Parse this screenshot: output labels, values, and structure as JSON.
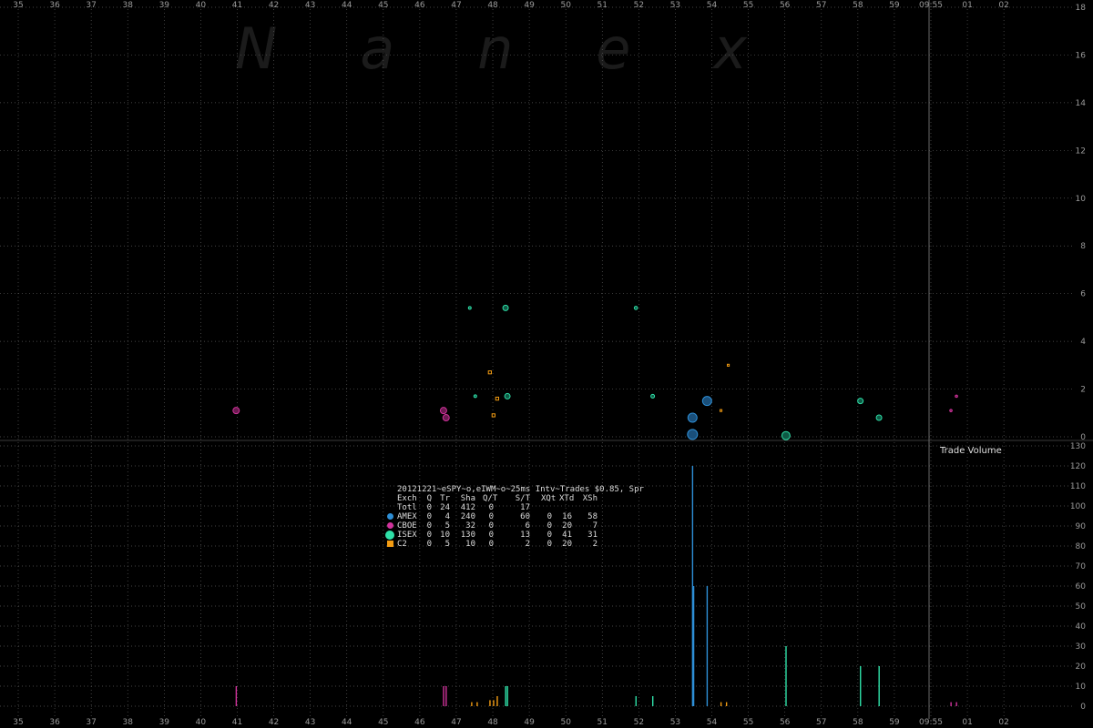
{
  "watermark": "N a n e x",
  "colors": {
    "amex": "#2e8fd6",
    "cboe": "#d1339c",
    "isex": "#2fe0a8",
    "c2": "#f39c12",
    "background": "#000000"
  },
  "top_time_labels": [
    "35",
    "36",
    "37",
    "38",
    "39",
    "40",
    "41",
    "42",
    "43",
    "44",
    "45",
    "46",
    "47",
    "48",
    "49",
    "50",
    "51",
    "52",
    "53",
    "54",
    "55",
    "56",
    "57",
    "58",
    "59",
    "09:55",
    "01",
    "02"
  ],
  "bottom_time_labels": [
    "35",
    "36",
    "37",
    "38",
    "39",
    "40",
    "41",
    "42",
    "43",
    "44",
    "45",
    "46",
    "47",
    "48",
    "49",
    "50",
    "51",
    "52",
    "53",
    "54",
    "55",
    "56",
    "57",
    "58",
    "59",
    "09:55",
    "01",
    "02"
  ],
  "legend": {
    "title": "20121221~eSPY~o,eIWM~o~25ms Intv~Trades $0.85, Spr",
    "header": [
      "Exch",
      "Q",
      "Tr",
      "Sha",
      "Q/T",
      "S/T",
      "XQt",
      "XTd",
      "XSh"
    ],
    "rows": [
      {
        "marker": "none",
        "cells": [
          "Totl",
          "0",
          "24",
          "412",
          "0",
          "17",
          "",
          "",
          ""
        ]
      },
      {
        "marker": "amex",
        "cells": [
          "AMEX",
          "0",
          "4",
          "240",
          "0",
          "60",
          "0",
          "16",
          "58"
        ]
      },
      {
        "marker": "cboe",
        "cells": [
          "CBOE",
          "0",
          "5",
          "32",
          "0",
          "6",
          "0",
          "20",
          "7"
        ]
      },
      {
        "marker": "isex",
        "cells": [
          "ISEX",
          "0",
          "10",
          "130",
          "0",
          "13",
          "0",
          "41",
          "31"
        ]
      },
      {
        "marker": "c2",
        "cells": [
          "C2",
          "0",
          "5",
          "10",
          "0",
          "2",
          "0",
          "20",
          "2"
        ]
      }
    ]
  },
  "chart_data": [
    {
      "type": "scatter",
      "title": "",
      "ylim": [
        0,
        18
      ],
      "yticks": [
        0,
        2,
        4,
        6,
        8,
        10,
        12,
        14,
        16,
        18
      ],
      "grid": true,
      "points": [
        {
          "exch": "cboe",
          "x": 40.97,
          "y": 1.1,
          "size": 3.5
        },
        {
          "exch": "cboe",
          "x": 46.65,
          "y": 1.1,
          "size": 3.5
        },
        {
          "exch": "cboe",
          "x": 46.72,
          "y": 0.8,
          "size": 3.5
        },
        {
          "exch": "isex",
          "x": 47.37,
          "y": 5.4,
          "size": 1.5
        },
        {
          "exch": "isex",
          "x": 47.52,
          "y": 1.7,
          "size": 1.5
        },
        {
          "exch": "c2",
          "x": 47.92,
          "y": 2.7,
          "size": 2.5
        },
        {
          "exch": "c2",
          "x": 48.02,
          "y": 0.9,
          "size": 2.5
        },
        {
          "exch": "c2",
          "x": 48.12,
          "y": 1.6,
          "size": 2.5
        },
        {
          "exch": "isex",
          "x": 48.35,
          "y": 5.4,
          "size": 3.0
        },
        {
          "exch": "isex",
          "x": 48.4,
          "y": 1.7,
          "size": 3.0
        },
        {
          "exch": "isex",
          "x": 51.92,
          "y": 5.4,
          "size": 1.8
        },
        {
          "exch": "isex",
          "x": 52.38,
          "y": 1.7,
          "size": 2.0
        },
        {
          "exch": "amex",
          "x": 53.47,
          "y": 0.8,
          "size": 5.0
        },
        {
          "exch": "amex",
          "x": 53.47,
          "y": 0.1,
          "size": 5.5
        },
        {
          "exch": "amex",
          "x": 53.87,
          "y": 1.5,
          "size": 5.0
        },
        {
          "exch": "c2",
          "x": 54.25,
          "y": 1.1,
          "size": 1.6
        },
        {
          "exch": "c2",
          "x": 54.45,
          "y": 3.0,
          "size": 1.6
        },
        {
          "exch": "isex",
          "x": 56.03,
          "y": 0.05,
          "size": 4.5
        },
        {
          "exch": "isex",
          "x": 58.07,
          "y": 1.5,
          "size": 3.0
        },
        {
          "exch": "isex",
          "x": 58.58,
          "y": 0.8,
          "size": 3.0
        },
        {
          "exch": "cboe",
          "x": 60.55,
          "y": 1.1,
          "size": 1.3
        },
        {
          "exch": "cboe",
          "x": 60.7,
          "y": 1.7,
          "size": 1.3
        }
      ]
    },
    {
      "type": "bar",
      "title": "Trade Volume",
      "ylim": [
        0,
        130
      ],
      "yticks": [
        0,
        10,
        20,
        30,
        40,
        50,
        60,
        70,
        80,
        90,
        100,
        110,
        120,
        130
      ],
      "grid": true,
      "bars": [
        {
          "exch": "cboe",
          "x": 40.97,
          "value": 10
        },
        {
          "exch": "cboe",
          "x": 46.65,
          "value": 10
        },
        {
          "exch": "cboe",
          "x": 46.72,
          "value": 10
        },
        {
          "exch": "c2",
          "x": 47.42,
          "value": 2
        },
        {
          "exch": "c2",
          "x": 47.57,
          "value": 2
        },
        {
          "exch": "c2",
          "x": 47.92,
          "value": 3
        },
        {
          "exch": "c2",
          "x": 48.02,
          "value": 3
        },
        {
          "exch": "c2",
          "x": 48.12,
          "value": 5
        },
        {
          "exch": "isex",
          "x": 48.35,
          "value": 10
        },
        {
          "exch": "isex",
          "x": 48.4,
          "value": 10
        },
        {
          "exch": "isex",
          "x": 51.92,
          "value": 5
        },
        {
          "exch": "isex",
          "x": 52.38,
          "value": 5
        },
        {
          "exch": "amex",
          "x": 53.47,
          "value": 120
        },
        {
          "exch": "amex",
          "x": 53.5,
          "value": 60
        },
        {
          "exch": "amex",
          "x": 53.87,
          "value": 60
        },
        {
          "exch": "c2",
          "x": 54.25,
          "value": 2
        },
        {
          "exch": "c2",
          "x": 54.4,
          "value": 2
        },
        {
          "exch": "isex",
          "x": 56.03,
          "value": 30
        },
        {
          "exch": "isex",
          "x": 58.07,
          "value": 20
        },
        {
          "exch": "isex",
          "x": 58.58,
          "value": 20
        },
        {
          "exch": "cboe",
          "x": 60.55,
          "value": 2
        },
        {
          "exch": "cboe",
          "x": 60.7,
          "value": 2
        }
      ]
    }
  ]
}
